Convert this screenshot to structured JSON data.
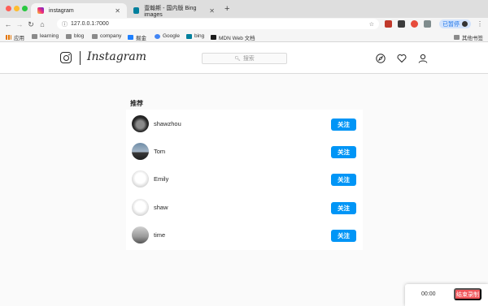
{
  "browser": {
    "tabs": [
      {
        "label": "instagram",
        "active": true
      },
      {
        "label": "壹翰斯 - 国内版 Bing images",
        "active": false
      }
    ],
    "address": "127.0.0.1:7000",
    "paused_label": "已暂停",
    "bookmarks": [
      {
        "label": "应用",
        "icon": "apps-grid-icon"
      },
      {
        "label": "learning",
        "icon": "folder-icon"
      },
      {
        "label": "blog",
        "icon": "folder-icon"
      },
      {
        "label": "company",
        "icon": "folder-icon"
      },
      {
        "label": "掘金",
        "icon": "juejin-icon"
      },
      {
        "label": "Google",
        "icon": "google-icon"
      },
      {
        "label": "bing",
        "icon": "bing-icon"
      },
      {
        "label": "MDN Web 文档",
        "icon": "mdn-icon"
      }
    ],
    "other_bookmarks": "其他书签"
  },
  "header": {
    "wordmark": "Instagram",
    "search_placeholder": "搜索"
  },
  "suggestions": {
    "title": "推荐",
    "follow_label": "关注",
    "users": [
      {
        "name": "shawzhou",
        "avatar": "dark-portrait"
      },
      {
        "name": "Tom",
        "avatar": "silhouette-sky"
      },
      {
        "name": "Emily",
        "avatar": "sketch-face"
      },
      {
        "name": "shaw",
        "avatar": "sketch-face"
      },
      {
        "name": "time",
        "avatar": "fog-silhouette"
      }
    ]
  },
  "recorder": {
    "time": "00:00",
    "stop_label": "结束录制"
  },
  "colors": {
    "accent": "#0095f6",
    "stop": "#f1555a"
  }
}
